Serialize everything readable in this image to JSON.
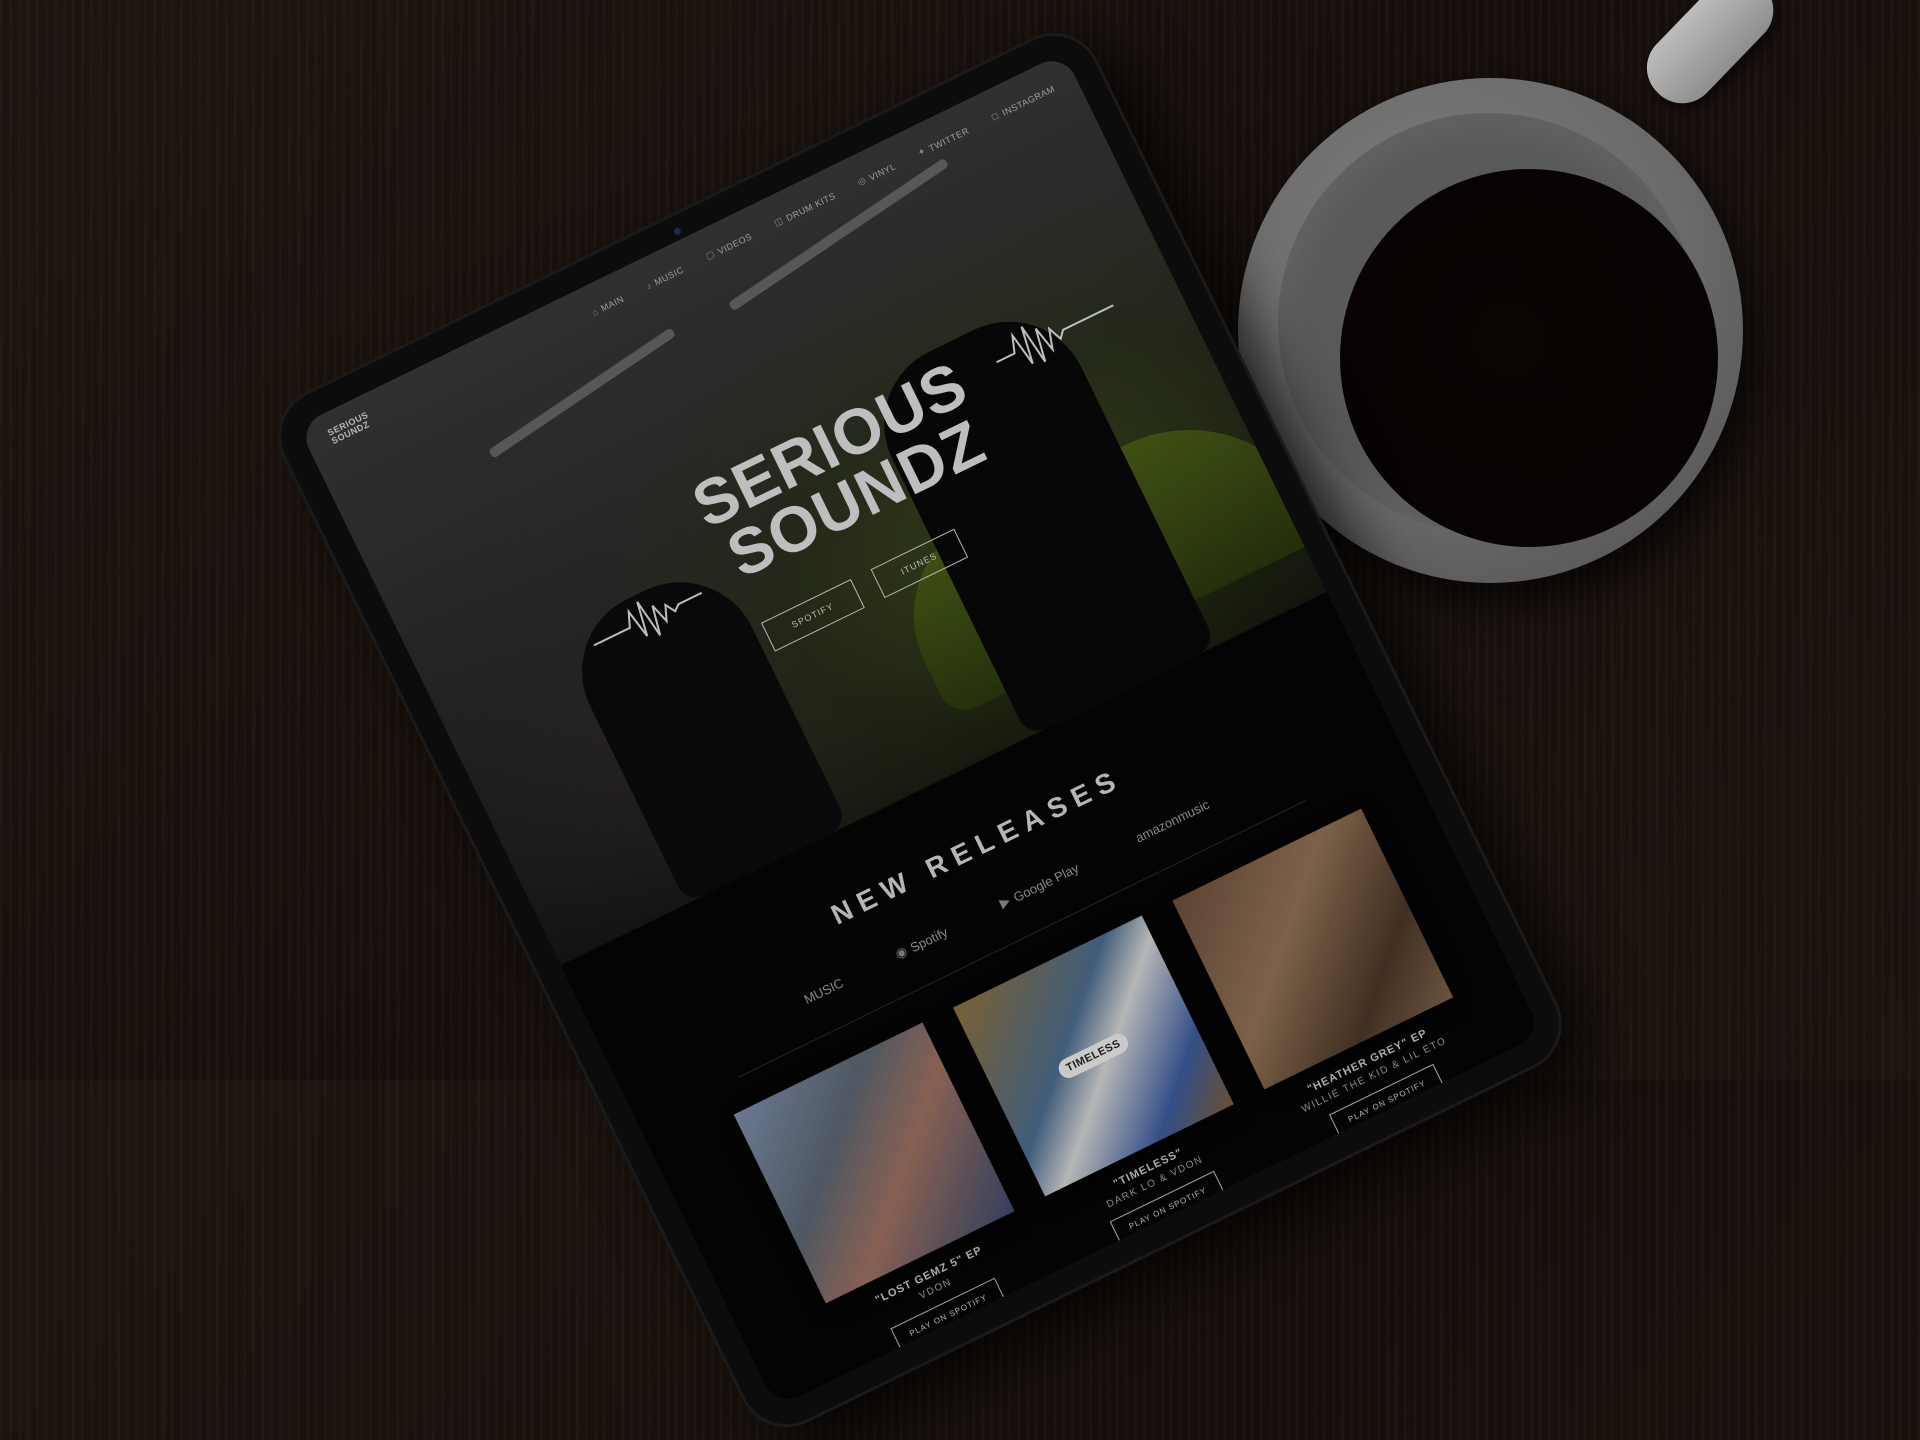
{
  "site": {
    "small_logo": [
      "SERIOUS",
      "SOUNDZ"
    ],
    "nav": [
      {
        "icon": "⌂",
        "label": "MAIN"
      },
      {
        "icon": "♪",
        "label": "MUSIC"
      },
      {
        "icon": "▢",
        "label": "VIDEOS"
      },
      {
        "icon": "◫",
        "label": "DRUM KITS"
      },
      {
        "icon": "◎",
        "label": "VINYL"
      },
      {
        "icon": "✦",
        "label": "TWITTER"
      },
      {
        "icon": "◻",
        "label": "INSTAGRAM"
      }
    ],
    "hero": {
      "logo_line1": "SERIOUS",
      "logo_line2": "SOUNDZ",
      "buttons": [
        "SPOTIFY",
        "ITUNES"
      ]
    },
    "releases": {
      "heading": "NEW RELEASES",
      "platforms": [
        {
          "icon": "",
          "label": "MUSIC"
        },
        {
          "icon": "◉",
          "label": "Spotify"
        },
        {
          "icon": "▶",
          "label": "Google Play"
        },
        {
          "icon": "",
          "label": "amazonmusic"
        }
      ],
      "albums": [
        {
          "title": "\"LOST GEMZ 5\" EP",
          "artist": "VDON",
          "cover_text": "",
          "button": "PLAY ON SPOTIFY"
        },
        {
          "title": "\"TIMELESS\"",
          "artist": "DARK LO & VDON",
          "cover_text": "TIMELESS",
          "button": "PLAY ON SPOTIFY"
        },
        {
          "title": "\"HEATHER GREY\" EP",
          "artist": "WILLIE THE KID & LIL ETO",
          "cover_text": "",
          "button": "PLAY ON SPOTIFY"
        }
      ]
    }
  },
  "colors": {
    "wood": "#1c140f",
    "accent_lime": "#6b8a1e",
    "text_light": "#d9d9d9"
  }
}
